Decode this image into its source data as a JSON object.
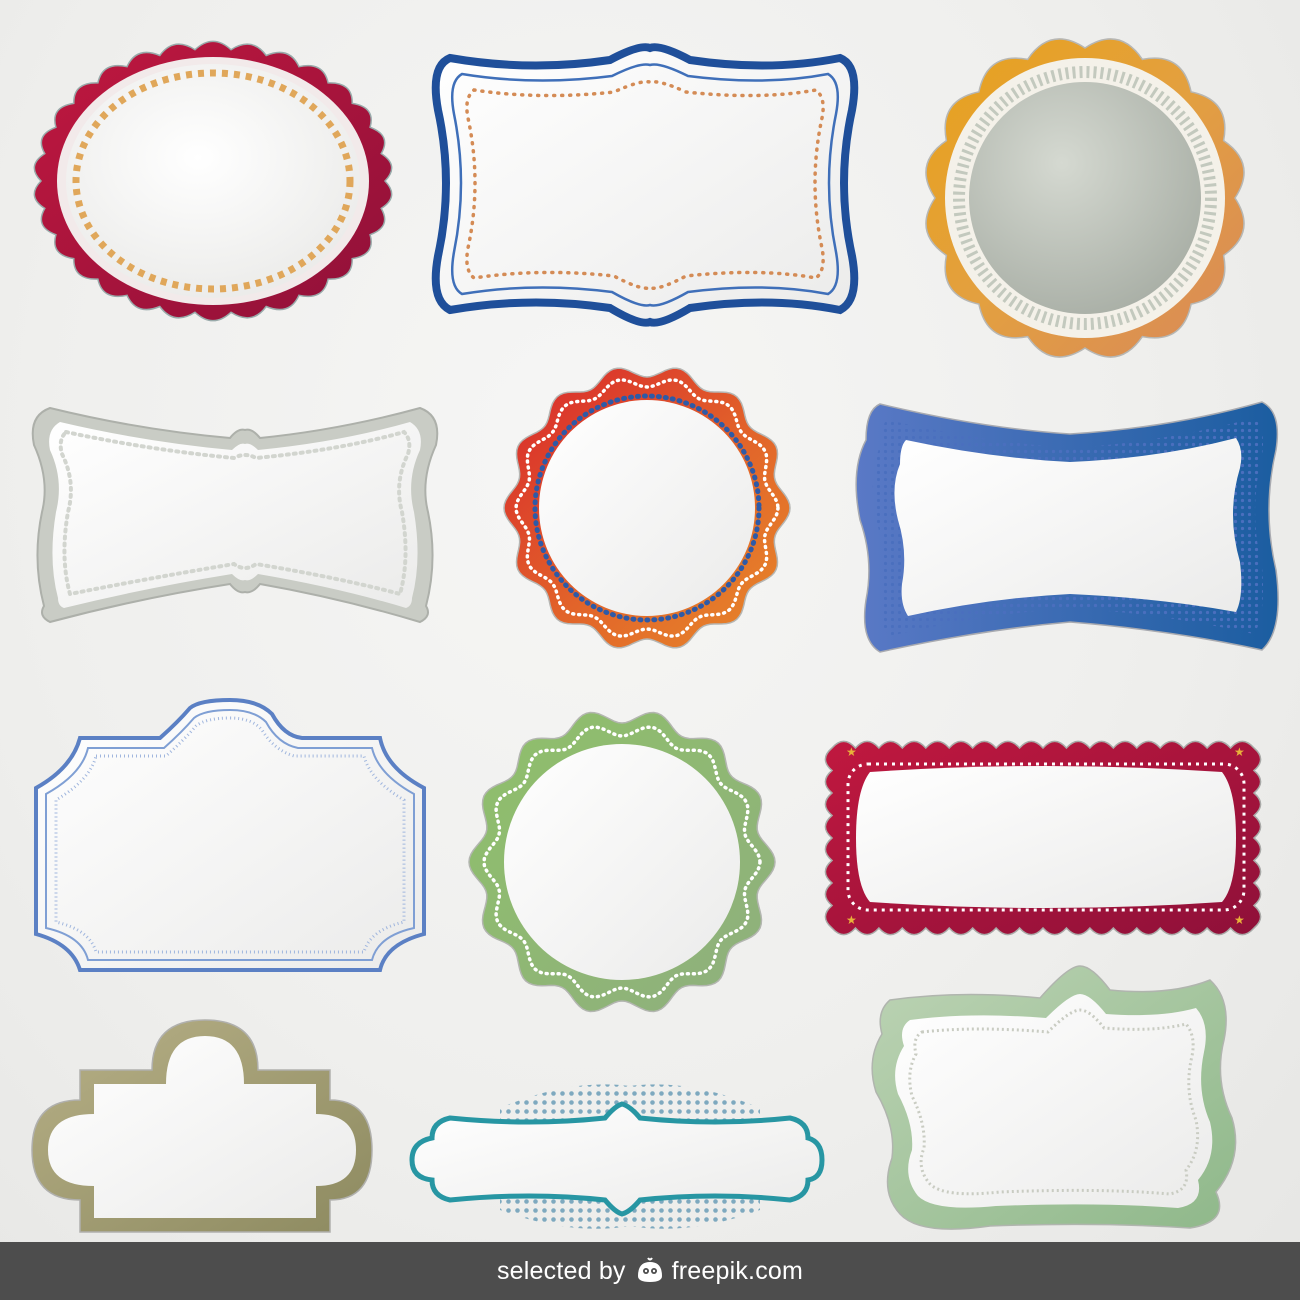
{
  "palette": {
    "background": "#efefed",
    "footer_bg": "#4d4d4d",
    "crimson": "#a5163f",
    "navy_blue": "#1f4f9a",
    "orange": "#e19b2c",
    "sage_grey": "#b7bdb4",
    "red_orange": "#d2452a",
    "periwinkle": "#4e6fc0",
    "light_blue": "#5b80c4",
    "green": "#7fb05c",
    "olive": "#a0996a",
    "teal": "#2796a3",
    "pale_green": "#9bc197"
  },
  "frames": [
    {
      "id": "scalloped-oval-crimson",
      "color": "#a5163f",
      "accent": "#e3a855"
    },
    {
      "id": "bracket-frame-navy",
      "color": "#1f4f9a",
      "accent": "#d48b55"
    },
    {
      "id": "scalloped-circle-orange",
      "color": "#e19b2c",
      "accent": "#c9cfc4"
    },
    {
      "id": "bowtie-frame-grey",
      "color": "#b7bdb4",
      "accent": "#ffffff"
    },
    {
      "id": "wavy-circle-rainbow",
      "color": "#d2452a",
      "accent": "#2e5aa7"
    },
    {
      "id": "bowtie-frame-blue-dotted",
      "color": "#4e6fc0",
      "accent": "#3f66b5"
    },
    {
      "id": "tab-frame-light-blue",
      "color": "#5b80c4",
      "accent": "#ffffff"
    },
    {
      "id": "wavy-circle-green",
      "color": "#7fb05c",
      "accent": "#ffffff"
    },
    {
      "id": "scalloped-banner-crimson",
      "color": "#a5163f",
      "accent": "#ffffff"
    },
    {
      "id": "quatrefoil-frame-olive",
      "color": "#a0996a",
      "accent": "#ffffff"
    },
    {
      "id": "bracket-frame-teal",
      "color": "#2796a3",
      "accent": "#7fb0c4"
    },
    {
      "id": "ornate-frame-pale-green",
      "color": "#9bc197",
      "accent": "#d0d3c8"
    }
  ],
  "footer": {
    "prefix": "selected by",
    "brand": "freepik.com",
    "logo_icon": "freepik-mascot-icon"
  }
}
